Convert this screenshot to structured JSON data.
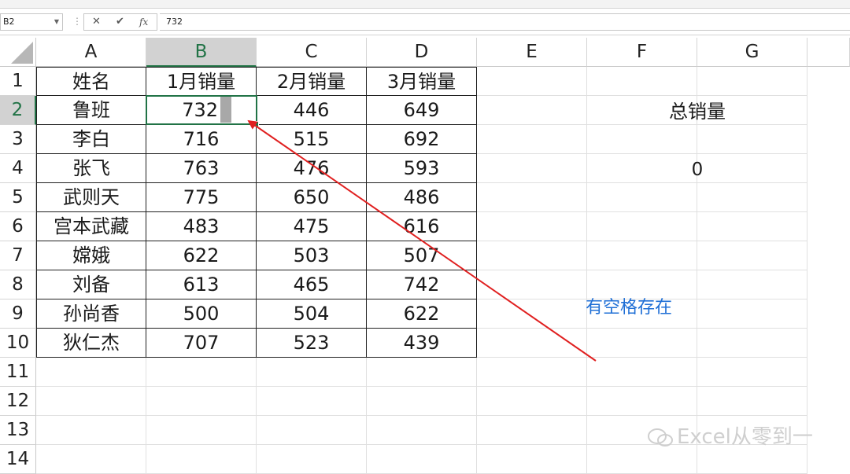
{
  "namebox": {
    "value": "B2"
  },
  "formula_bar": {
    "value": "732",
    "cancel_icon": "✕",
    "enter_icon": "✔",
    "fx_icon": "fx"
  },
  "columns": [
    "A",
    "B",
    "C",
    "D",
    "E",
    "F",
    "G"
  ],
  "rows": [
    "1",
    "2",
    "3",
    "4",
    "5",
    "6",
    "7",
    "8",
    "9",
    "10",
    "11",
    "12",
    "13",
    "14"
  ],
  "table": {
    "headers": [
      "姓名",
      "1月销量",
      "2月销量",
      "3月销量"
    ],
    "data": [
      [
        "鲁班",
        "732",
        "446",
        "649"
      ],
      [
        "李白",
        "716",
        "515",
        "692"
      ],
      [
        "张飞",
        "763",
        "476",
        "593"
      ],
      [
        "武则天",
        "775",
        "650",
        "486"
      ],
      [
        "宫本武藏",
        "483",
        "475",
        "616"
      ],
      [
        "嫦娥",
        "622",
        "503",
        "507"
      ],
      [
        "刘备",
        "613",
        "465",
        "742"
      ],
      [
        "孙尚香",
        "500",
        "504",
        "622"
      ],
      [
        "狄仁杰",
        "707",
        "523",
        "439"
      ]
    ]
  },
  "summary": {
    "label": "总销量",
    "value": "0"
  },
  "annotation": {
    "text": "有空格存在",
    "color": "#1f6fd6"
  },
  "arrow_color": "#e02020",
  "accent": "#217346",
  "watermark": {
    "text": "Excel从零到一"
  }
}
